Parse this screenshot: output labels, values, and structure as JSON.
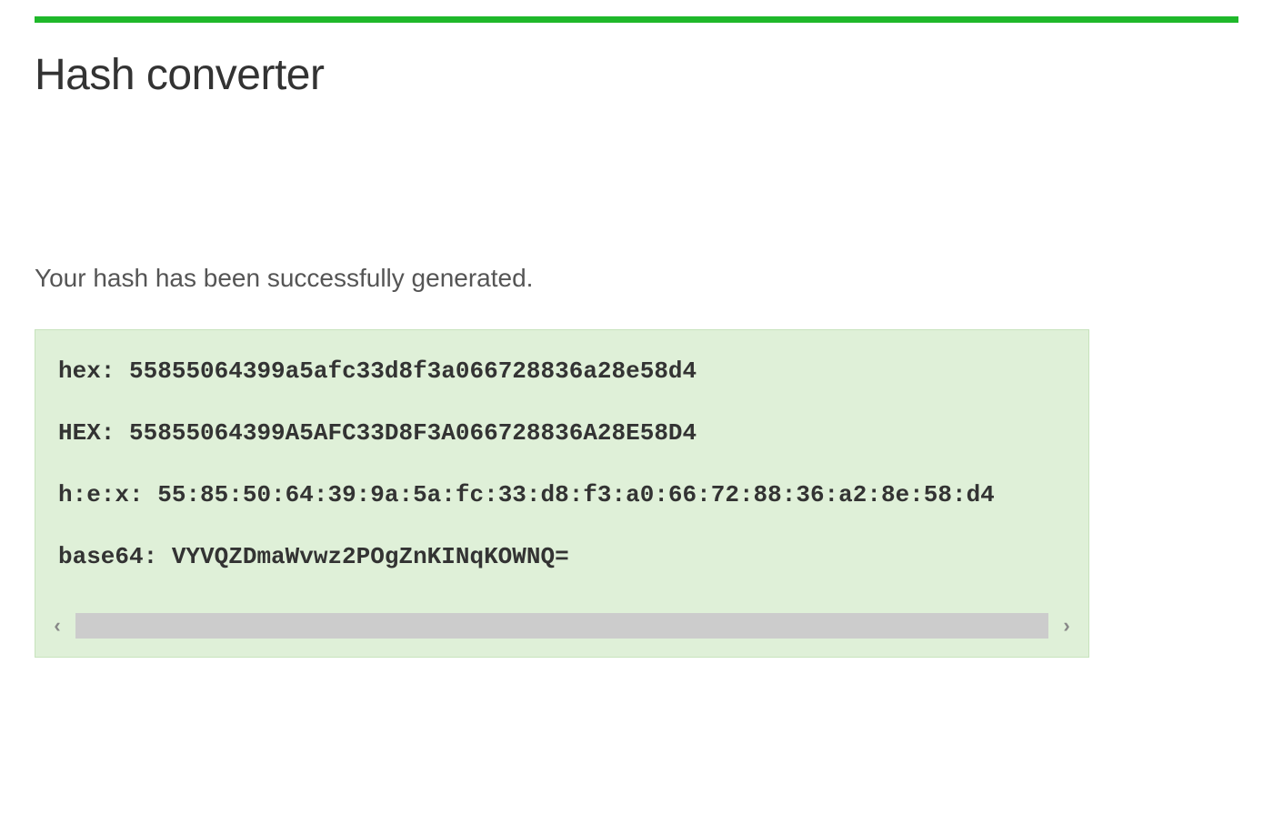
{
  "header": {
    "title": "Hash converter"
  },
  "status": {
    "message": "Your hash has been successfully generated."
  },
  "results": {
    "lines": [
      {
        "label": "hex:",
        "value": "55855064399a5afc33d8f3a066728836a28e58d4"
      },
      {
        "label": "HEX:",
        "value": "55855064399A5AFC33D8F3A066728836A28E58D4"
      },
      {
        "label": "h:e:x:",
        "value": "55:85:50:64:39:9a:5a:fc:33:d8:f3:a0:66:72:88:36:a2:8e:58:d4"
      },
      {
        "label": "base64:",
        "value": "VYVQZDmaWvwz2POgZnKINqKOWNQ="
      }
    ]
  },
  "scroll": {
    "left_arrow": "‹",
    "right_arrow": "›"
  }
}
